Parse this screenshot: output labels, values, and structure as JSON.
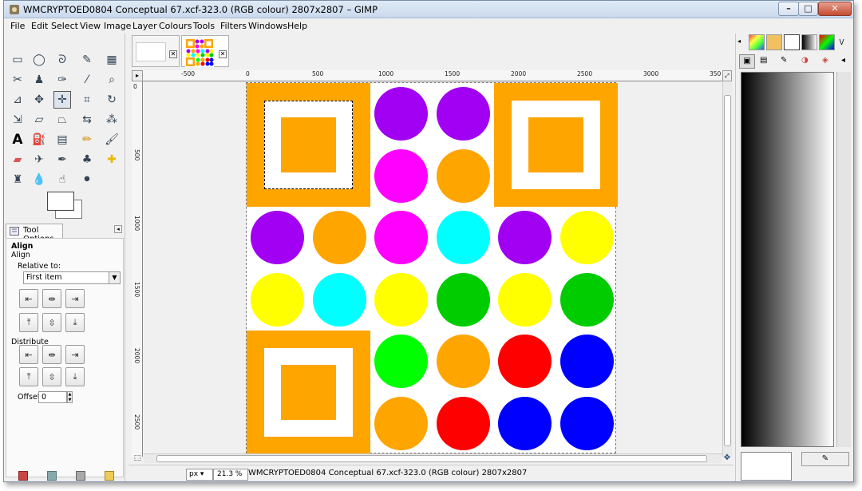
{
  "window": {
    "title": "WMCRYPTOED0804 Conceptual 67.xcf-323.0 (RGB colour) 2807x2807 – GIMP"
  },
  "menu": [
    "File",
    "Edit",
    "Select",
    "View",
    "Image",
    "Layer",
    "Colours",
    "Tools",
    "Filters",
    "Windows",
    "Help"
  ],
  "tool_options": {
    "tab_label": "Tool Options",
    "heading": "Align",
    "subheading": "Align",
    "relative_label": "Relative to:",
    "relative_value": "First item",
    "distribute_label": "Distribute",
    "offset_label": "Offset:",
    "offset_value": "0"
  },
  "ruler": {
    "top_labels": [
      "-500",
      "0",
      "500",
      "1000",
      "1500",
      "2000",
      "2500",
      "3000",
      "350"
    ],
    "left_labels": [
      "0",
      "500",
      "1000",
      "1500",
      "2000",
      "2500"
    ]
  },
  "status": {
    "unit": "px",
    "zoom": "21.3 %",
    "text": "WMCRYPTOED0804 Conceptual 67.xcf-323.0 (RGB colour) 2807x2807"
  },
  "colors": {
    "orange": "#ffa500",
    "purple": "#a100f2",
    "magenta": "#ff00ff",
    "cyan": "#00ffff",
    "yellow": "#ffff00",
    "green": "#00cc00",
    "lime": "#00ff00",
    "red": "#ff0000",
    "blue": "#0000ff"
  },
  "grid": [
    [
      "square",
      "purple",
      "purple",
      "square"
    ],
    [
      "square",
      "magenta",
      "orange",
      "square"
    ],
    [
      "purple",
      "orange",
      "magenta",
      "cyan",
      "purple",
      "yellow"
    ],
    [
      "yellow",
      "cyan",
      "yellow",
      "green",
      "yellow",
      "green"
    ],
    [
      "square",
      "lime",
      "orange",
      "red",
      "blue"
    ],
    [
      "square",
      "orange",
      "red",
      "blue",
      "blue"
    ]
  ]
}
